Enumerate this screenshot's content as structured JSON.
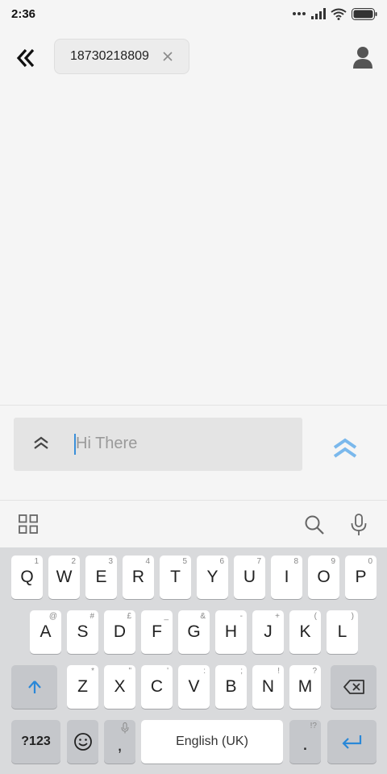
{
  "status_bar": {
    "time": "2:36"
  },
  "header": {
    "recipient": "18730218809"
  },
  "compose": {
    "placeholder": "Hi There"
  },
  "keyboard": {
    "row1": [
      {
        "label": "Q",
        "hint": "1"
      },
      {
        "label": "W",
        "hint": "2"
      },
      {
        "label": "E",
        "hint": "3"
      },
      {
        "label": "R",
        "hint": "4"
      },
      {
        "label": "T",
        "hint": "5"
      },
      {
        "label": "Y",
        "hint": "6"
      },
      {
        "label": "U",
        "hint": "7"
      },
      {
        "label": "I",
        "hint": "8"
      },
      {
        "label": "O",
        "hint": "9"
      },
      {
        "label": "P",
        "hint": "0"
      }
    ],
    "row2": [
      {
        "label": "A",
        "hint": "@"
      },
      {
        "label": "S",
        "hint": "#"
      },
      {
        "label": "D",
        "hint": "£"
      },
      {
        "label": "F",
        "hint": "_"
      },
      {
        "label": "G",
        "hint": "&"
      },
      {
        "label": "H",
        "hint": "-"
      },
      {
        "label": "J",
        "hint": "+"
      },
      {
        "label": "K",
        "hint": "("
      },
      {
        "label": "L",
        "hint": ")"
      }
    ],
    "row3": [
      {
        "label": "Z",
        "hint": "*"
      },
      {
        "label": "X",
        "hint": "\""
      },
      {
        "label": "C",
        "hint": "'"
      },
      {
        "label": "V",
        "hint": ":"
      },
      {
        "label": "B",
        "hint": ";"
      },
      {
        "label": "N",
        "hint": "!"
      },
      {
        "label": "M",
        "hint": "?"
      }
    ],
    "symbols_label": "?123",
    "comma_label": ",",
    "space_label": "English (UK)",
    "period_label": ".",
    "period_hint": "!?"
  },
  "colors": {
    "accent": "#3a8fd9",
    "send": "#7ab8ec"
  }
}
